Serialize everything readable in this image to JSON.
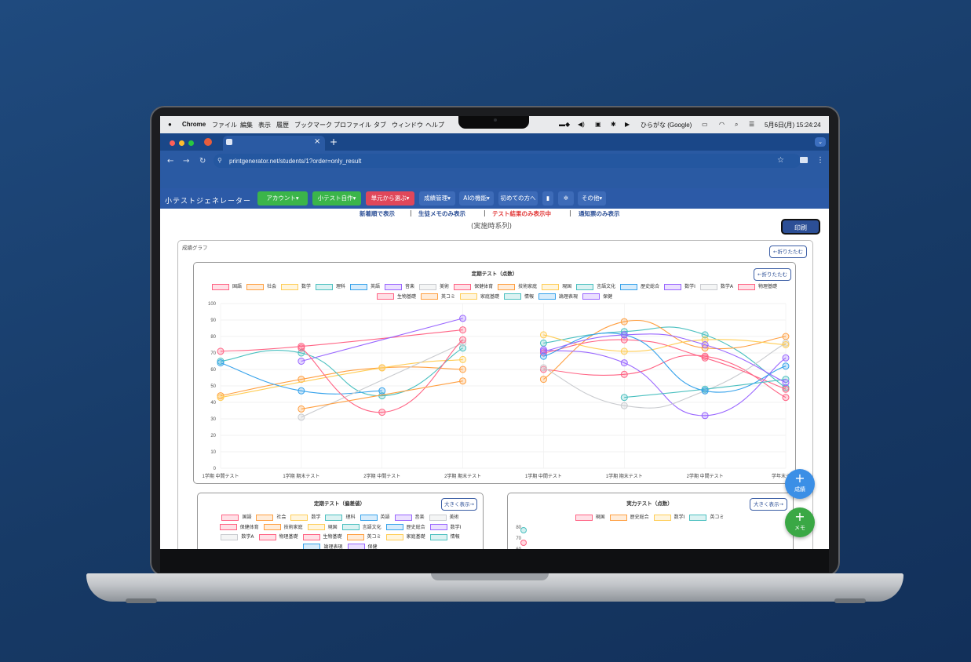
{
  "menubar": {
    "apple": "",
    "items": [
      "Chrome",
      "ファイル",
      "編集",
      "表示",
      "履歴",
      "ブックマーク",
      "プロファイル",
      "タブ",
      "ウィンドウ",
      "ヘルプ"
    ],
    "status_input": "ひらがな (Google)",
    "datetime": "5月6日(月) 15:24:24"
  },
  "browser": {
    "url": "printgenerator.net/students/1?order=only_result"
  },
  "app": {
    "title": "小テストジェネレーター",
    "nav": [
      {
        "label": "アカウント▾",
        "color": "#3bb54a"
      },
      {
        "label": "小テスト自作▾",
        "color": "#3bb54a"
      },
      {
        "label": "単元から選ぶ▾",
        "color": "#e0475a"
      },
      {
        "label": "成績管理▾",
        "color": "#3d6bb8"
      },
      {
        "label": "AIの機能▾",
        "color": "#3d6bb8"
      },
      {
        "label": "初めての方へ",
        "color": "#3d6bb8"
      },
      {
        "label": "",
        "color": "#3d6bb8"
      },
      {
        "label": "",
        "color": "#3d6bb8"
      },
      {
        "label": "その他▾",
        "color": "#3d6bb8"
      }
    ]
  },
  "filters": {
    "newest": "新着順で表示",
    "memo_only": "生徒メモのみ表示",
    "test_only": "テスト結果のみ表示中",
    "notice_only": "通知票のみ表示",
    "sep": "|"
  },
  "subtitle": "(実施時系列)",
  "print_label": "印刷",
  "grades_graph_label": "成績グラフ",
  "collapse_label": "←折りたたむ",
  "expand_label": "大きく表示→",
  "main_chart_title": "定期テスト（点数）",
  "deviation_chart_title": "定期テスト（偏差値）",
  "ability_chart_title": "実力テスト（点数）",
  "fab_grades": "成績",
  "fab_memo": "メモ",
  "legend_main": [
    {
      "name": "国語",
      "color": "#ff6384"
    },
    {
      "name": "社会",
      "color": "#ff9f40"
    },
    {
      "name": "数学",
      "color": "#ffcd56"
    },
    {
      "name": "理科",
      "color": "#4bc0c0"
    },
    {
      "name": "英語",
      "color": "#36a2eb"
    },
    {
      "name": "音楽",
      "color": "#9966ff"
    },
    {
      "name": "美術",
      "color": "#c9cbcf"
    },
    {
      "name": "保健体育",
      "color": "#ff6384"
    },
    {
      "name": "技術家庭",
      "color": "#ff9f40"
    },
    {
      "name": "現国",
      "color": "#ffcd56"
    },
    {
      "name": "言語文化",
      "color": "#4bc0c0"
    },
    {
      "name": "歴史総合",
      "color": "#36a2eb"
    },
    {
      "name": "数学Ⅰ",
      "color": "#9966ff"
    },
    {
      "name": "数学A",
      "color": "#c9cbcf"
    },
    {
      "name": "物理基礎",
      "color": "#ff6384"
    },
    {
      "name": "生物基礎",
      "color": "#ff6384"
    },
    {
      "name": "英コミ",
      "color": "#ff9f40"
    },
    {
      "name": "家庭基礎",
      "color": "#ffcd56"
    },
    {
      "name": "情報",
      "color": "#4bc0c0"
    },
    {
      "name": "論理表現",
      "color": "#36a2eb"
    },
    {
      "name": "保健",
      "color": "#9966ff"
    }
  ],
  "legend_ability": [
    {
      "name": "現国",
      "color": "#ff6384"
    },
    {
      "name": "歴史総合",
      "color": "#ff9f40"
    },
    {
      "name": "数学Ⅰ",
      "color": "#ffcd56"
    },
    {
      "name": "英コミ",
      "color": "#4bc0c0"
    }
  ],
  "chart_data": {
    "type": "line",
    "title": "定期テスト（点数）",
    "categories": [
      "1学期 中間テスト",
      "1学期 期末テスト",
      "2学期 中間テスト",
      "2学期 期末テスト",
      "1学期 中間テスト",
      "1学期 期末テスト",
      "2学期 中間テスト",
      "学年末テスト"
    ],
    "ylim": [
      0,
      100
    ],
    "yticks": [
      0,
      10,
      20,
      30,
      40,
      50,
      60,
      70,
      80,
      90,
      100
    ],
    "grid": true,
    "legend_position": "top",
    "series": [
      {
        "name": "国語",
        "color": "#ff6384",
        "values": [
          71,
          74,
          null,
          84,
          null,
          null,
          null,
          null
        ]
      },
      {
        "name": "社会",
        "color": "#ff9f40",
        "values": [
          44,
          54,
          61,
          60,
          null,
          null,
          null,
          null
        ]
      },
      {
        "name": "数学",
        "color": "#ffcd56",
        "values": [
          43,
          null,
          61,
          66,
          null,
          null,
          null,
          null
        ]
      },
      {
        "name": "理科",
        "color": "#4bc0c0",
        "values": [
          65,
          70,
          44,
          73,
          null,
          null,
          null,
          null
        ]
      },
      {
        "name": "英語",
        "color": "#36a2eb",
        "values": [
          64,
          47,
          47,
          null,
          null,
          null,
          null,
          null
        ]
      },
      {
        "name": "音楽",
        "color": "#9966ff",
        "values": [
          null,
          65,
          null,
          91,
          null,
          null,
          null,
          null
        ]
      },
      {
        "name": "美術",
        "color": "#c9cbcf",
        "values": [
          null,
          31,
          null,
          76,
          null,
          null,
          null,
          null
        ]
      },
      {
        "name": "保健体育",
        "color": "#ff6384",
        "values": [
          null,
          73,
          34,
          78,
          null,
          null,
          null,
          null
        ]
      },
      {
        "name": "技術家庭",
        "color": "#ff9f40",
        "values": [
          null,
          36,
          null,
          53,
          null,
          null,
          null,
          null
        ]
      },
      {
        "name": "現国",
        "color": "#ff6384",
        "values": [
          null,
          null,
          null,
          null,
          60,
          57,
          68,
          43
        ]
      },
      {
        "name": "言語文化",
        "color": "#4bc0c0",
        "values": [
          null,
          null,
          null,
          null,
          76,
          83,
          81,
          49
        ]
      },
      {
        "name": "歴史総合",
        "color": "#ff9f40",
        "values": [
          null,
          null,
          null,
          null,
          54,
          89,
          73,
          80
        ]
      },
      {
        "name": "数学Ⅰ",
        "color": "#9966ff",
        "values": [
          null,
          null,
          null,
          null,
          72,
          64,
          32,
          67
        ]
      },
      {
        "name": "数学A",
        "color": "#c9cbcf",
        "values": [
          null,
          null,
          null,
          null,
          61,
          38,
          47,
          76
        ]
      },
      {
        "name": "物理基礎",
        "color": "#ff6384",
        "values": [
          null,
          null,
          null,
          null,
          70,
          78,
          67,
          48
        ]
      },
      {
        "name": "英コミ",
        "color": "#ffcd56",
        "values": [
          null,
          null,
          null,
          null,
          81,
          71,
          78,
          75
        ]
      },
      {
        "name": "情報",
        "color": "#4bc0c0",
        "values": [
          null,
          null,
          null,
          null,
          null,
          43,
          48,
          54
        ]
      },
      {
        "name": "論理表現",
        "color": "#36a2eb",
        "values": [
          null,
          null,
          null,
          null,
          68,
          81,
          47,
          62
        ]
      },
      {
        "name": "保健",
        "color": "#9966ff",
        "values": [
          null,
          null,
          null,
          null,
          71,
          81,
          75,
          52
        ]
      }
    ]
  },
  "ability_yticks": [
    "80",
    "70",
    "60"
  ]
}
